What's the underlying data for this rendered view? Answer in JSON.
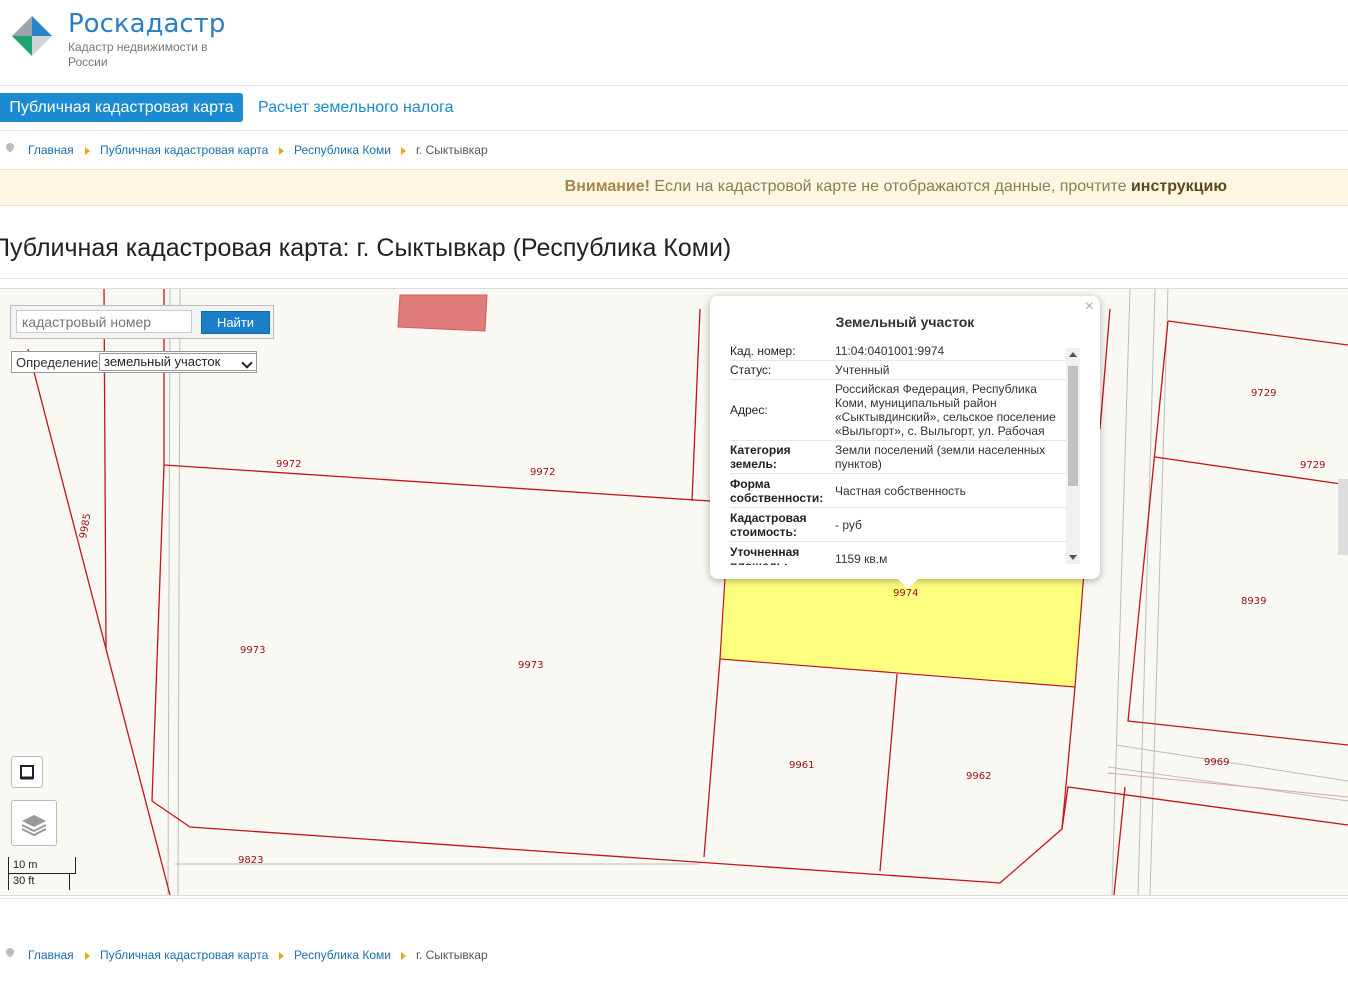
{
  "header": {
    "brand": "Роскадастр",
    "subtitle": "Кадастр недвижимости в России"
  },
  "nav": {
    "active": "Публичная кадастровая карта",
    "link": "Расчет земельного налога"
  },
  "breadcrumbs": [
    "Главная",
    "Публичная кадастровая карта",
    "Республика Коми",
    "г. Сыктывкар"
  ],
  "notice": {
    "strong": "Внимание!",
    "text": " Если на кадастровой карте не отображаются данные, прочтите ",
    "link": "инструкцию"
  },
  "page_title": "Публичная кадастровая карта: г. Сыктывкар (Республика Коми)",
  "map": {
    "search_placeholder": "кадастровый номер",
    "search_button": "Найти",
    "definition_label": "Определение:",
    "definition_value": "земельный участок",
    "scale_metric": "10 m",
    "scale_imperial": "30 ft",
    "plot_labels": [
      "9972",
      "9972",
      "9985",
      "9973",
      "9973",
      "9974",
      "9961",
      "9962",
      "9823",
      "9729",
      "9729",
      "8939",
      "9969"
    ],
    "selected_fill": "#ffff80",
    "boundary_color": "#c4141a",
    "popup": {
      "title": "Земельный участок",
      "close": "×",
      "rows": [
        {
          "key": "Кад. номер:",
          "value": "11:04:0401001:9974"
        },
        {
          "key": "Статус:",
          "value": "Учтенный"
        },
        {
          "key": "Адрес:",
          "value": "Российская Федерация, Республика Коми, муниципальный район «Сыктывдинский», сельское поселение «Выльгорт», с. Выльгорт, ул. Рабочая"
        },
        {
          "key": "Категория земель:",
          "value": "Земли поселений (земли населенных пунктов)"
        },
        {
          "key": "Форма собственности:",
          "value": "Частная собственность"
        },
        {
          "key": "Кадастровая стоимость:",
          "value": "- руб"
        },
        {
          "key": "Уточненная площадь:",
          "value": "1159 кв.м"
        }
      ]
    }
  }
}
